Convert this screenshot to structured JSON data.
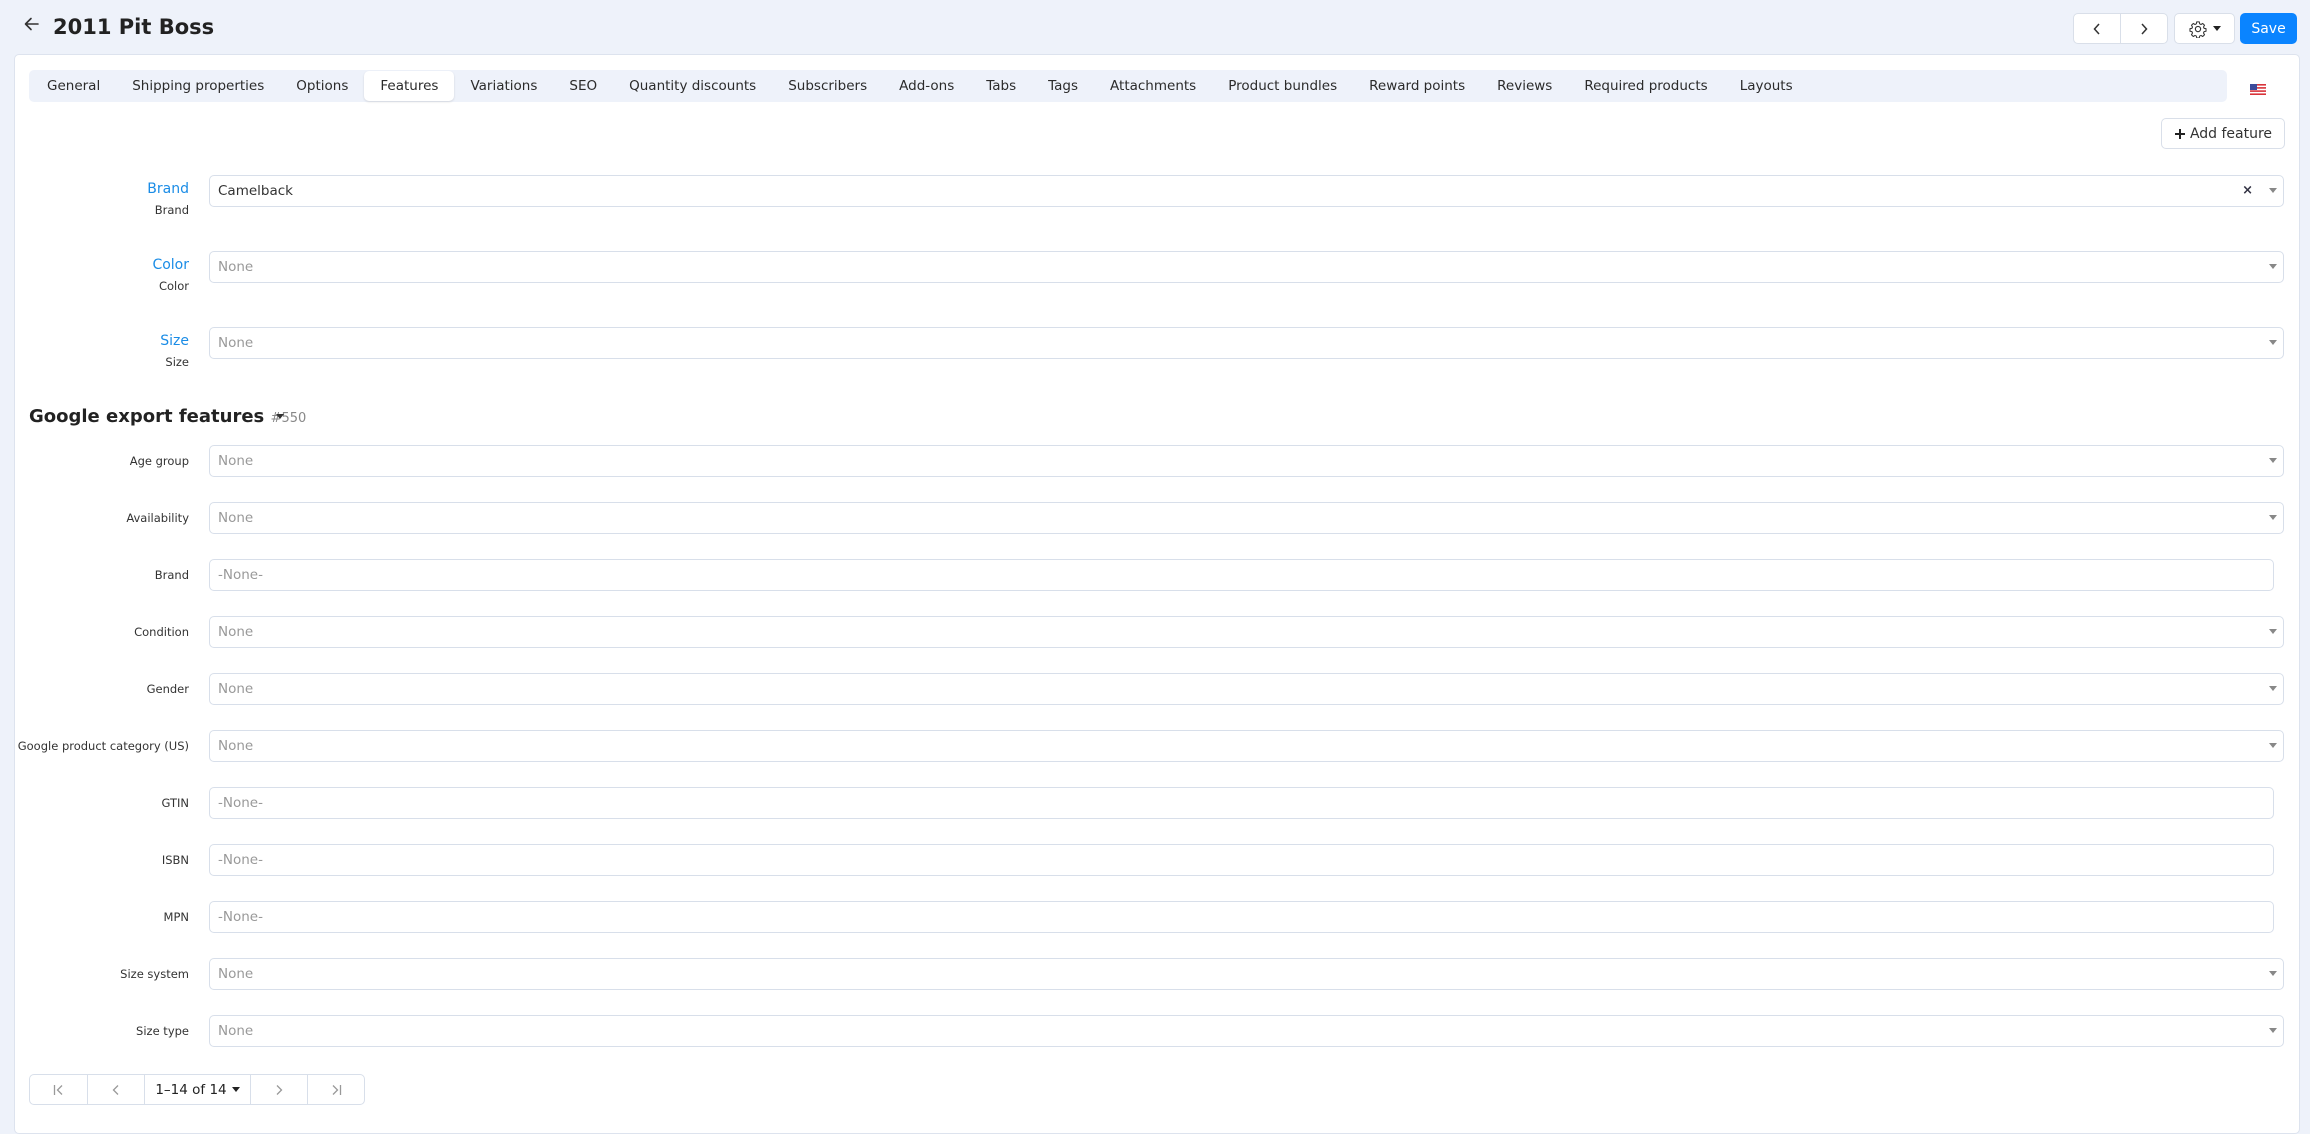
{
  "header": {
    "title": "2011 Pit Boss",
    "back_icon": "arrow-left-icon",
    "prev_glyph": "‹",
    "next_glyph": "›",
    "save_label": "Save"
  },
  "tabs": [
    {
      "label": "General",
      "active": false
    },
    {
      "label": "Shipping properties",
      "active": false
    },
    {
      "label": "Options",
      "active": false
    },
    {
      "label": "Features",
      "active": true
    },
    {
      "label": "Variations",
      "active": false
    },
    {
      "label": "SEO",
      "active": false
    },
    {
      "label": "Quantity discounts",
      "active": false
    },
    {
      "label": "Subscribers",
      "active": false
    },
    {
      "label": "Add-ons",
      "active": false
    },
    {
      "label": "Tabs",
      "active": false
    },
    {
      "label": "Tags",
      "active": false
    },
    {
      "label": "Attachments",
      "active": false
    },
    {
      "label": "Product bundles",
      "active": false
    },
    {
      "label": "Reward points",
      "active": false
    },
    {
      "label": "Reviews",
      "active": false
    },
    {
      "label": "Required products",
      "active": false
    },
    {
      "label": "Layouts",
      "active": false
    }
  ],
  "language_flag": "us-flag",
  "add_feature_label": "Add feature",
  "features": [
    {
      "name": "Brand",
      "sublabel": "Brand",
      "value": "Camelback",
      "placeholder": "None",
      "clearable": true
    },
    {
      "name": "Color",
      "sublabel": "Color",
      "value": "",
      "placeholder": "None",
      "clearable": false
    },
    {
      "name": "Size",
      "sublabel": "Size",
      "value": "",
      "placeholder": "None",
      "clearable": false
    }
  ],
  "google_section": {
    "title": "Google export features",
    "id": "#550",
    "fields": [
      {
        "label": "Age group",
        "type": "select",
        "placeholder": "None"
      },
      {
        "label": "Availability",
        "type": "select",
        "placeholder": "None"
      },
      {
        "label": "Brand",
        "type": "text",
        "placeholder": "-None-"
      },
      {
        "label": "Condition",
        "type": "select",
        "placeholder": "None"
      },
      {
        "label": "Gender",
        "type": "select",
        "placeholder": "None"
      },
      {
        "label": "Google product category (US)",
        "type": "select",
        "placeholder": "None"
      },
      {
        "label": "GTIN",
        "type": "text",
        "placeholder": "-None-"
      },
      {
        "label": "ISBN",
        "type": "text",
        "placeholder": "-None-"
      },
      {
        "label": "MPN",
        "type": "text",
        "placeholder": "-None-"
      },
      {
        "label": "Size system",
        "type": "select",
        "placeholder": "None"
      },
      {
        "label": "Size type",
        "type": "select",
        "placeholder": "None"
      }
    ]
  },
  "pagination": {
    "first_glyph": "|‹",
    "prev_glyph": "‹",
    "range_label": "1–14 of 14",
    "next_glyph": "›",
    "last_glyph": "›|"
  },
  "colors": {
    "accent": "#0a84ff",
    "feature_label": "#1a8ce6",
    "background": "#eef2fa"
  }
}
